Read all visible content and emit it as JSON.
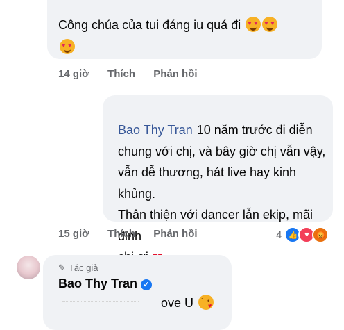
{
  "comment1": {
    "text": "Công chúa của tui đáng iu quá đi",
    "time": "14 giờ",
    "like_label": "Thích",
    "reply_label": "Phản hồi"
  },
  "comment2": {
    "author": "Bao Thy Tran",
    "line1": "10 năm trước đi diễn",
    "line2": "chung với chị, và bây giờ chị vẫn vậy,",
    "line3": "vẫn dễ thương, hát live hay kinh khủng.",
    "line4": "Thân thiện với dancer lẫn ekip, mãi đỉnh",
    "line5": "chị ơi",
    "time": "15 giờ",
    "like_label": "Thích",
    "reply_label": "Phản hồi",
    "reaction_count": "4"
  },
  "reply": {
    "badge": "Tác giả",
    "author": "Bao Thy Tran",
    "text": "ove U"
  },
  "colors": {
    "bubble": "#f0f2f5",
    "link": "#385898",
    "meta": "#65676b",
    "like": "#1877f2",
    "love": "#f33e58"
  }
}
